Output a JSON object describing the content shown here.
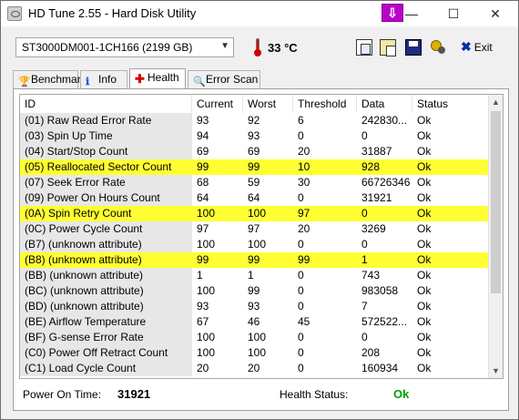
{
  "window": {
    "title": "HD Tune 2.55 - Hard Disk Utility",
    "close": "✕",
    "tray": "⇩"
  },
  "toolbar": {
    "drive": "ST3000DM001-1CH166 (2199 GB)",
    "temperature": "33 °C",
    "exit_label": "Exit",
    "icons": [
      "copy-icon",
      "paste-icon",
      "save-icon",
      "options-icon",
      "exit-icon"
    ]
  },
  "tabs": [
    {
      "label": "Benchmark",
      "icon": "benchmark-icon"
    },
    {
      "label": "Info",
      "icon": "info-icon"
    },
    {
      "label": "Health",
      "icon": "health-cross-icon",
      "active": true
    },
    {
      "label": "Error Scan",
      "icon": "magnifier-icon"
    }
  ],
  "table": {
    "columns": [
      "ID",
      "Current",
      "Worst",
      "Threshold",
      "Data",
      "Status"
    ],
    "rows": [
      {
        "id": "(01) Raw Read Error Rate",
        "current": "93",
        "worst": "92",
        "threshold": "6",
        "data": "242830...",
        "status": "Ok",
        "highlight": false
      },
      {
        "id": "(03) Spin Up Time",
        "current": "94",
        "worst": "93",
        "threshold": "0",
        "data": "0",
        "status": "Ok",
        "highlight": false
      },
      {
        "id": "(04) Start/Stop Count",
        "current": "69",
        "worst": "69",
        "threshold": "20",
        "data": "31887",
        "status": "Ok",
        "highlight": false
      },
      {
        "id": "(05) Reallocated Sector Count",
        "current": "99",
        "worst": "99",
        "threshold": "10",
        "data": "928",
        "status": "Ok",
        "highlight": true
      },
      {
        "id": "(07) Seek Error Rate",
        "current": "68",
        "worst": "59",
        "threshold": "30",
        "data": "66726346",
        "status": "Ok",
        "highlight": false
      },
      {
        "id": "(09) Power On Hours Count",
        "current": "64",
        "worst": "64",
        "threshold": "0",
        "data": "31921",
        "status": "Ok",
        "highlight": false
      },
      {
        "id": "(0A) Spin Retry Count",
        "current": "100",
        "worst": "100",
        "threshold": "97",
        "data": "0",
        "status": "Ok",
        "highlight": true
      },
      {
        "id": "(0C) Power Cycle Count",
        "current": "97",
        "worst": "97",
        "threshold": "20",
        "data": "3269",
        "status": "Ok",
        "highlight": false
      },
      {
        "id": "(B7) (unknown attribute)",
        "current": "100",
        "worst": "100",
        "threshold": "0",
        "data": "0",
        "status": "Ok",
        "highlight": false
      },
      {
        "id": "(B8) (unknown attribute)",
        "current": "99",
        "worst": "99",
        "threshold": "99",
        "data": "1",
        "status": "Ok",
        "highlight": true
      },
      {
        "id": "(BB) (unknown attribute)",
        "current": "1",
        "worst": "1",
        "threshold": "0",
        "data": "743",
        "status": "Ok",
        "highlight": false
      },
      {
        "id": "(BC) (unknown attribute)",
        "current": "100",
        "worst": "99",
        "threshold": "0",
        "data": "983058",
        "status": "Ok",
        "highlight": false
      },
      {
        "id": "(BD) (unknown attribute)",
        "current": "93",
        "worst": "93",
        "threshold": "0",
        "data": "7",
        "status": "Ok",
        "highlight": false
      },
      {
        "id": "(BE) Airflow Temperature",
        "current": "67",
        "worst": "46",
        "threshold": "45",
        "data": "572522...",
        "status": "Ok",
        "highlight": false
      },
      {
        "id": "(BF) G-sense Error Rate",
        "current": "100",
        "worst": "100",
        "threshold": "0",
        "data": "0",
        "status": "Ok",
        "highlight": false
      },
      {
        "id": "(C0) Power Off Retract Count",
        "current": "100",
        "worst": "100",
        "threshold": "0",
        "data": "208",
        "status": "Ok",
        "highlight": false
      },
      {
        "id": "(C1) Load Cycle Count",
        "current": "20",
        "worst": "20",
        "threshold": "0",
        "data": "160934",
        "status": "Ok",
        "highlight": false
      }
    ]
  },
  "footer": {
    "power_on_label": "Power On Time:",
    "power_on_value": "31921",
    "health_label": "Health Status:",
    "health_value": "Ok"
  },
  "colors": {
    "highlight": "#ffff33",
    "ok_green": "#00a000",
    "tray_purple": "#bb00cc",
    "temp_red": "#d40000"
  }
}
